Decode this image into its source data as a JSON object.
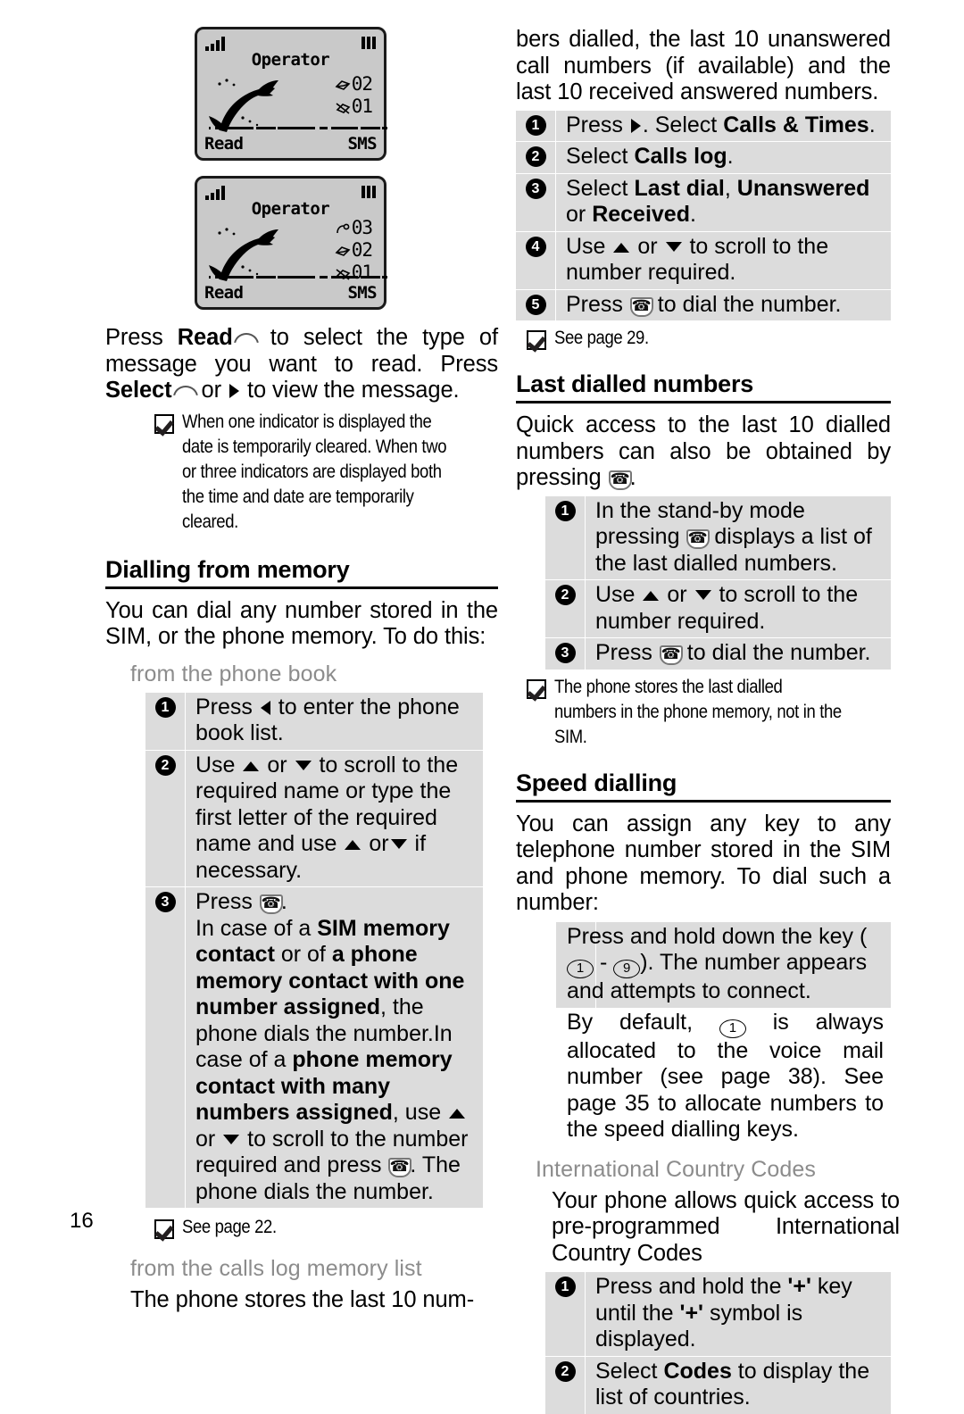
{
  "page": {
    "number": "16"
  },
  "phone_screens": [
    {
      "operator": "Operator",
      "left_softkey": "Read",
      "right_softkey": "SMS",
      "indicators": [
        {
          "icon": "envelope-icon",
          "count": "02"
        },
        {
          "icon": "crossed-envelope-icon",
          "count": "01"
        }
      ]
    },
    {
      "operator": "Operator",
      "left_softkey": "Read",
      "right_softkey": "SMS",
      "indicators": [
        {
          "icon": "missed-call-icon",
          "count": "03"
        },
        {
          "icon": "envelope-icon",
          "count": "02"
        },
        {
          "icon": "crossed-envelope-icon",
          "count": "01"
        }
      ]
    }
  ],
  "left_column": {
    "intro_p1_a": "Press ",
    "intro_p1_b": "Read",
    "intro_p1_c": " to select the type of message you want to read. Press ",
    "intro_p1_d": "Select",
    "intro_p1_e": " or ",
    "intro_p1_f": " to view the message.",
    "note_indicators": "When one indicator is displayed the date is temporarily cleared. When two or three indicators are displayed both the time and date are temporarily cleared.",
    "heading_dialling": "Dialling from memory",
    "dialling_intro": "You can dial any number stored in the SIM, or the phone memory. To do this:",
    "sub_phonebook": "from the phone book",
    "steps_phonebook": [
      {
        "num": "1",
        "parts": [
          {
            "t": "Press "
          },
          {
            "icon": "left-arrow-icon"
          },
          {
            "t": " to enter the phone book list."
          }
        ]
      },
      {
        "num": "2",
        "parts": [
          {
            "t": "Use "
          },
          {
            "icon": "up-arrow-icon"
          },
          {
            "t": " or "
          },
          {
            "icon": "down-arrow-icon"
          },
          {
            "t": " to scroll to the required name or type the first letter of the required name and use "
          },
          {
            "icon": "up-arrow-icon"
          },
          {
            "t": " or"
          },
          {
            "icon": "down-arrow-icon"
          },
          {
            "t": " if necessary."
          }
        ]
      },
      {
        "num": "3",
        "parts": [
          {
            "t": "Press "
          },
          {
            "icon": "call-key-icon"
          },
          {
            "t": "."
          },
          {
            "br": true
          },
          {
            "t": "In case of a "
          },
          {
            "t": "SIM memory contact",
            "b": true
          },
          {
            "t": " or of "
          },
          {
            "t": "a phone memory contact with one number assigned",
            "b": true
          },
          {
            "t": ", the phone dials the number.In case of a "
          },
          {
            "t": "phone memory contact with many numbers assigned",
            "b": true
          },
          {
            "t": ", use "
          },
          {
            "icon": "up-arrow-icon"
          },
          {
            "t": " or "
          },
          {
            "icon": "down-arrow-icon"
          },
          {
            "t": " to scroll to the number required and press "
          },
          {
            "icon": "call-key-icon"
          },
          {
            "t": ". The phone dials the number."
          }
        ]
      }
    ],
    "note_see_page_22": "See page 22.",
    "sub_callslog": "from the calls log memory list",
    "callslog_text": "The phone stores the last 10 num-"
  },
  "right_column": {
    "continued_text": "bers dialled, the last 10 unanswered call numbers (if available) and the last 10 received answered numbers.",
    "steps_callslog": [
      {
        "num": "1",
        "parts": [
          {
            "t": "Press "
          },
          {
            "icon": "right-arrow-icon"
          },
          {
            "t": ". Select "
          },
          {
            "t": "Calls & Times",
            "b": true
          },
          {
            "t": "."
          }
        ]
      },
      {
        "num": "2",
        "parts": [
          {
            "t": "Select "
          },
          {
            "t": "Calls log",
            "b": true
          },
          {
            "t": "."
          }
        ]
      },
      {
        "num": "3",
        "parts": [
          {
            "t": "Select "
          },
          {
            "t": "Last dial",
            "b": true
          },
          {
            "t": ", "
          },
          {
            "t": "Unanswered",
            "b": true
          },
          {
            "t": " or "
          },
          {
            "t": "Received",
            "b": true
          },
          {
            "t": "."
          }
        ]
      },
      {
        "num": "4",
        "parts": [
          {
            "t": "Use "
          },
          {
            "icon": "up-arrow-icon"
          },
          {
            "t": " or "
          },
          {
            "icon": "down-arrow-icon"
          },
          {
            "t": " to scroll to the number required."
          }
        ]
      },
      {
        "num": "5",
        "parts": [
          {
            "t": "Press "
          },
          {
            "icon": "call-key-icon"
          },
          {
            "t": " to dial the number."
          }
        ]
      }
    ],
    "note_see_page_29": "See page 29.",
    "heading_lastdialled": "Last dialled numbers",
    "lastdialled_intro_a": "Quick access to the last 10 dialled numbers can also be obtained by pressing ",
    "lastdialled_intro_b": ".",
    "steps_lastdialled": [
      {
        "num": "1",
        "parts": [
          {
            "t": "In the stand-by mode pressing "
          },
          {
            "icon": "call-key-icon"
          },
          {
            "t": " displays a list of the last dialled numbers."
          }
        ]
      },
      {
        "num": "2",
        "parts": [
          {
            "t": "Use "
          },
          {
            "icon": "up-arrow-icon"
          },
          {
            "t": " or "
          },
          {
            "icon": "down-arrow-icon"
          },
          {
            "t": " to scroll to the number required."
          }
        ]
      },
      {
        "num": "3",
        "parts": [
          {
            "t": "Press "
          },
          {
            "icon": "call-key-icon"
          },
          {
            "t": " to dial the number."
          }
        ]
      }
    ],
    "note_stores": "The phone stores the last dialled numbers in the phone memory, not in the SIM.",
    "heading_speed": "Speed dialling",
    "speed_intro": "You can assign any key to any telephone number stored in the SIM and phone memory. To dial such a number:",
    "speed_box": [
      {
        "t": "Press and hold down the key ("
      },
      {
        "key": "1"
      },
      {
        "t": " - "
      },
      {
        "key": "9"
      },
      {
        "t": "). The number appears and attempts to connect."
      }
    ],
    "speed_default": [
      {
        "t": "By default, "
      },
      {
        "key": "1"
      },
      {
        "t": " is always allocated to the voice mail number (see page 38). See page 35 to allocate numbers to the speed dialling keys."
      }
    ],
    "sub_intl": "International Country Codes",
    "intl_text": "Your phone allows quick access to pre-programmed International Country Codes",
    "steps_intl": [
      {
        "num": "1",
        "parts": [
          {
            "t": "Press and hold the "
          },
          {
            "t": "'+'",
            "b": true
          },
          {
            "t": " key until the "
          },
          {
            "t": "'+'",
            "b": true
          },
          {
            "t": " symbol is displayed."
          }
        ]
      },
      {
        "num": "2",
        "parts": [
          {
            "t": "Select "
          },
          {
            "t": "Codes",
            "b": true
          },
          {
            "t": " to display the list of countries."
          }
        ]
      }
    ]
  },
  "colors": {
    "step_box_bg": "#dcdcdc",
    "subheading": "#8c8c8c",
    "phone_screen_bg": "#c9c9c9",
    "text": "#000000"
  }
}
